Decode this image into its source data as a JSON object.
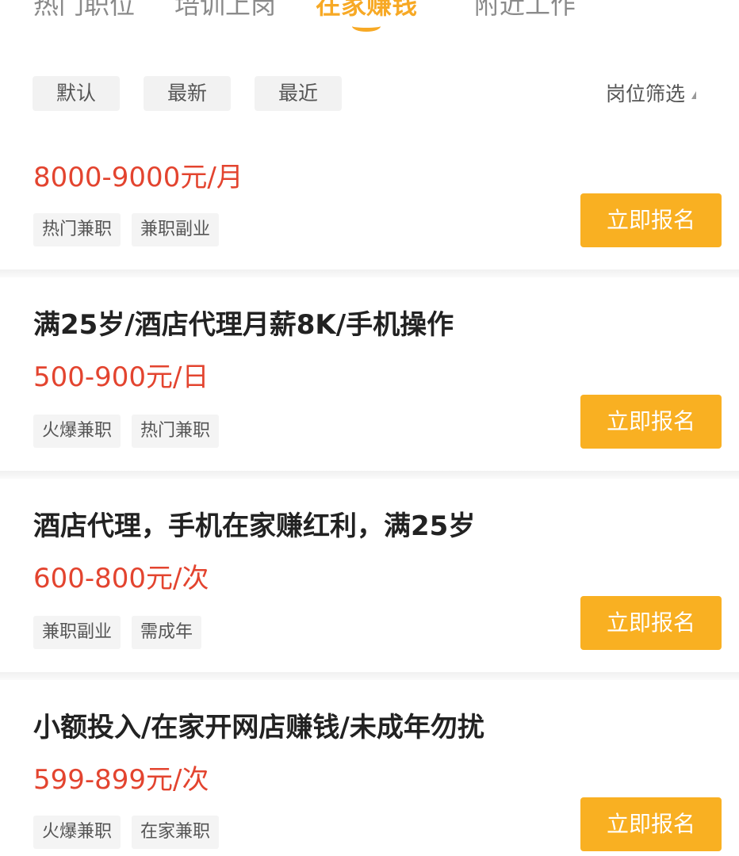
{
  "tabs": [
    {
      "label": "热门职位"
    },
    {
      "label": "培训上岗"
    },
    {
      "label": "在家赚钱",
      "active": true
    },
    {
      "label": "附近工作"
    }
  ],
  "sort": [
    "默认",
    "最新",
    "最近"
  ],
  "filter_label": "岗位筛选",
  "apply_label": "立即报名",
  "jobs": [
    {
      "title": "",
      "salary": "8000-9000元/月",
      "tags": [
        "热门兼职",
        "兼职副业"
      ]
    },
    {
      "title": "满25岁/酒店代理月薪8K/手机操作",
      "salary": "500-900元/日",
      "tags": [
        "火爆兼职",
        "热门兼职"
      ]
    },
    {
      "title": "酒店代理，手机在家赚红利，满25岁",
      "salary": "600-800元/次",
      "tags": [
        "兼职副业",
        "需成年"
      ]
    },
    {
      "title": "小额投入/在家开网店赚钱/未成年勿扰",
      "salary": "599-899元/次",
      "tags": [
        "火爆兼职",
        "在家兼职"
      ]
    }
  ],
  "colors": {
    "accent": "#f7a925",
    "apply_button": "#f9b022",
    "salary": "#e3442f"
  }
}
